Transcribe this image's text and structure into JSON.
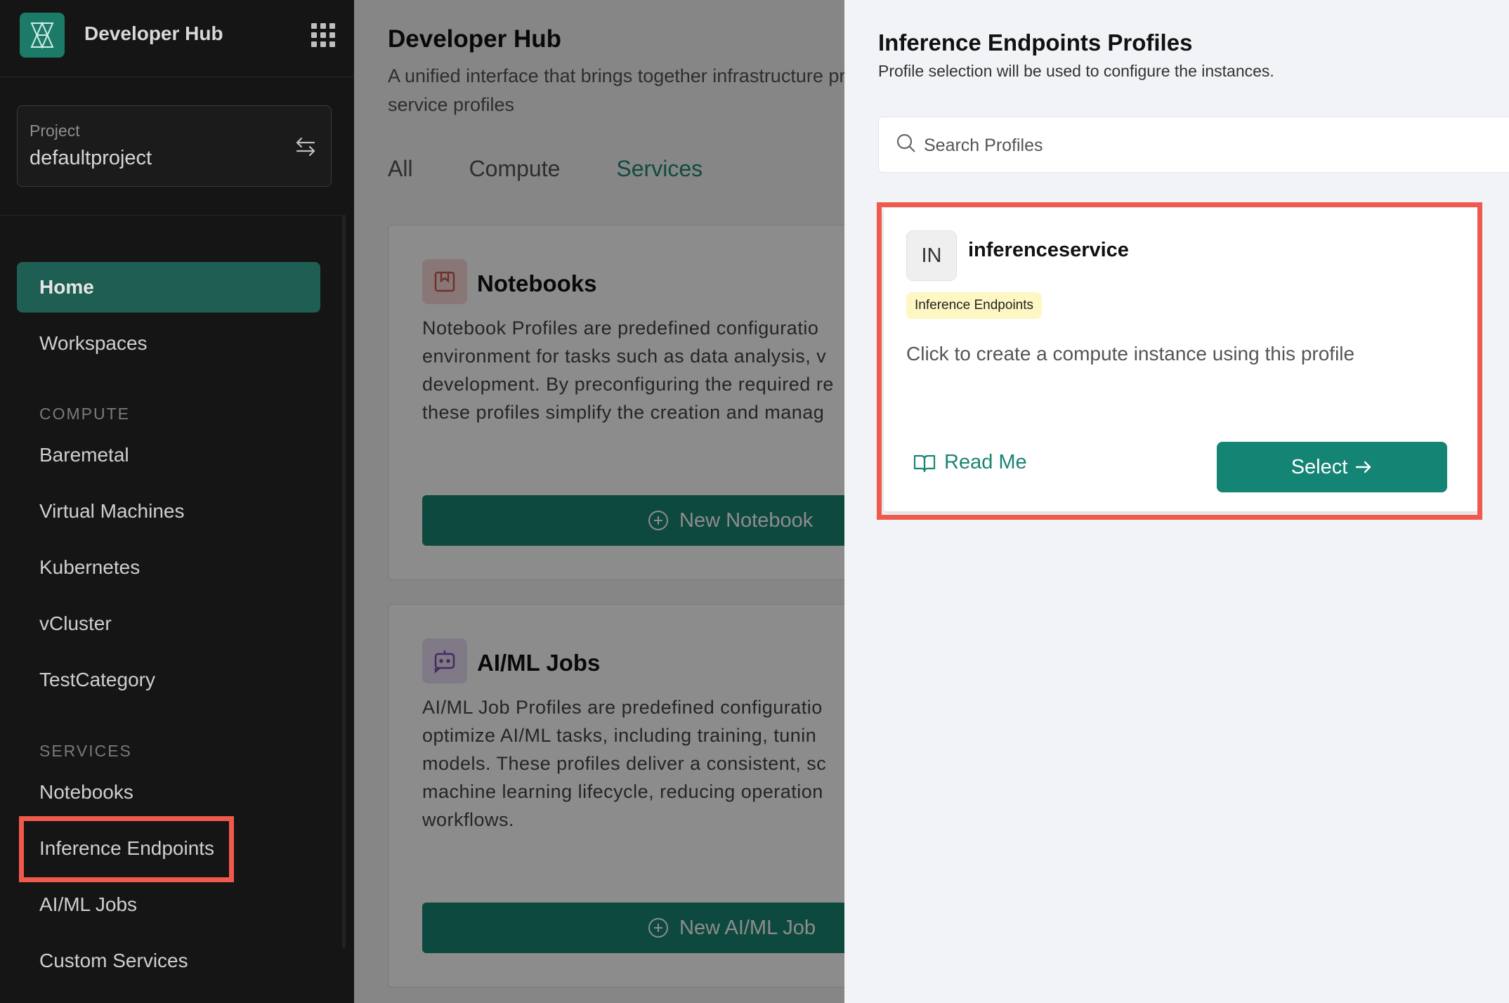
{
  "sidebar": {
    "app_name": "Developer Hub",
    "project": {
      "label": "Project",
      "value": "defaultproject"
    },
    "nav_top": [
      {
        "label": "Home",
        "active": true
      },
      {
        "label": "Workspaces",
        "active": false
      }
    ],
    "section_compute": "COMPUTE",
    "compute_items": [
      "Baremetal",
      "Virtual Machines",
      "Kubernetes",
      "vCluster",
      "TestCategory"
    ],
    "section_services": "SERVICES",
    "services_items": [
      "Notebooks",
      "Inference Endpoints",
      "AI/ML Jobs",
      "Custom Services"
    ]
  },
  "main": {
    "title": "Developer Hub",
    "description": "A unified interface that brings together infrastructure predefined compute or service profiles",
    "tabs": [
      "All",
      "Compute",
      "Services"
    ],
    "active_tab": "Services",
    "cards": [
      {
        "title": "Notebooks",
        "description": "Notebook Profiles are predefined configuratio environment for tasks such as data analysis, v development. By preconfiguring the required re these profiles simplify the creation and manag",
        "button": "New Notebook",
        "icon": "notebook-icon"
      },
      {
        "title": "AI/ML Jobs",
        "description": "AI/ML Job Profiles are predefined configuratio optimize AI/ML tasks, including training, tunin models. These profiles deliver a consistent, sc machine learning lifecycle, reducing operation workflows.",
        "button": "New AI/ML Job",
        "icon": "bot-icon"
      }
    ]
  },
  "drawer": {
    "title": "Inference Endpoints Profiles",
    "subtitle": "Profile selection will be used to configure the instances.",
    "search_placeholder": "Search Profiles",
    "profile": {
      "avatar": "IN",
      "name": "inferenceservice",
      "badge": "Inference Endpoints",
      "description": "Click to create a compute instance using this profile",
      "readme": "Read Me",
      "select": "Select"
    }
  },
  "colors": {
    "accent": "#1a8573",
    "highlight": "#ef5a4c",
    "sidebar_bg": "#151515",
    "badge_bg": "#fef7c3"
  }
}
